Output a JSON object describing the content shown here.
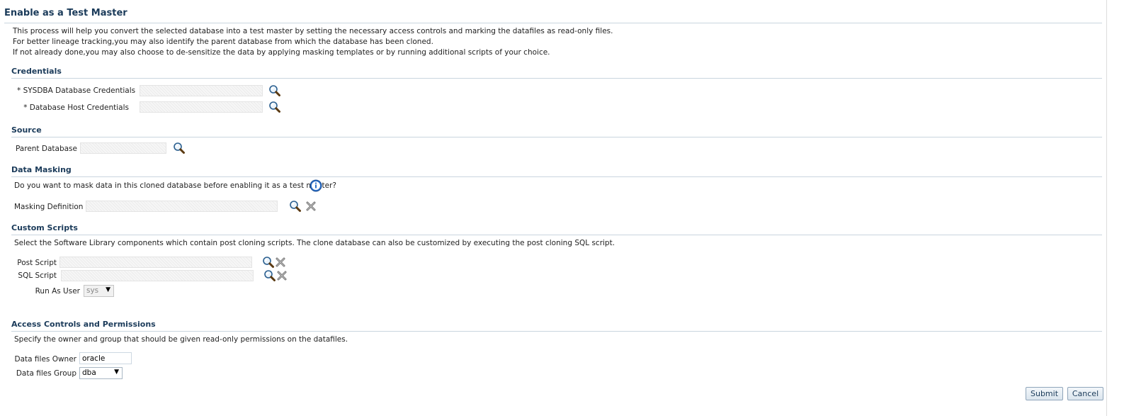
{
  "page_title": "Enable as a Test Master",
  "intro": {
    "line1": "This process will help you convert the selected database into a test master by setting the necessary access controls and marking the datafiles as read-only files.",
    "line2": "For better lineage tracking,you may also identify the parent database from which the database has been cloned.",
    "line3": "If not already done,you may also choose to de-sensitize the data by applying masking templates or by running additional scripts of your choice."
  },
  "credentials": {
    "title": "Credentials",
    "sysdba_label": "* SYSDBA Database Credentials",
    "host_label": "* Database Host Credentials"
  },
  "source": {
    "title": "Source",
    "parent_label": "Parent Database"
  },
  "masking": {
    "title": "Data Masking",
    "question": "Do you want to mask data in this cloned database before enabling it as a test master?",
    "definition_label": "Masking Definition"
  },
  "scripts": {
    "title": "Custom Scripts",
    "description": "Select the Software Library components which contain post cloning scripts. The clone database can also be customized by executing the post cloning SQL script.",
    "post_label": "Post Script",
    "sql_label": "SQL Script",
    "run_as_label": "Run As User",
    "run_as_value": "sys"
  },
  "access": {
    "title": "Access Controls and Permissions",
    "description": "Specify the owner and group that should be given read-only permissions on the datafiles.",
    "owner_label": "Data files Owner",
    "owner_value": "oracle",
    "group_label": "Data files Group",
    "group_value": "dba"
  },
  "buttons": {
    "submit": "Submit",
    "cancel": "Cancel"
  },
  "colors": {
    "heading": "#1b3b5a",
    "rule": "#c9d5df",
    "info_icon": "#2a6fc9"
  },
  "icons": [
    "search-icon",
    "clear-icon",
    "info-icon",
    "dropdown-arrow-icon"
  ]
}
